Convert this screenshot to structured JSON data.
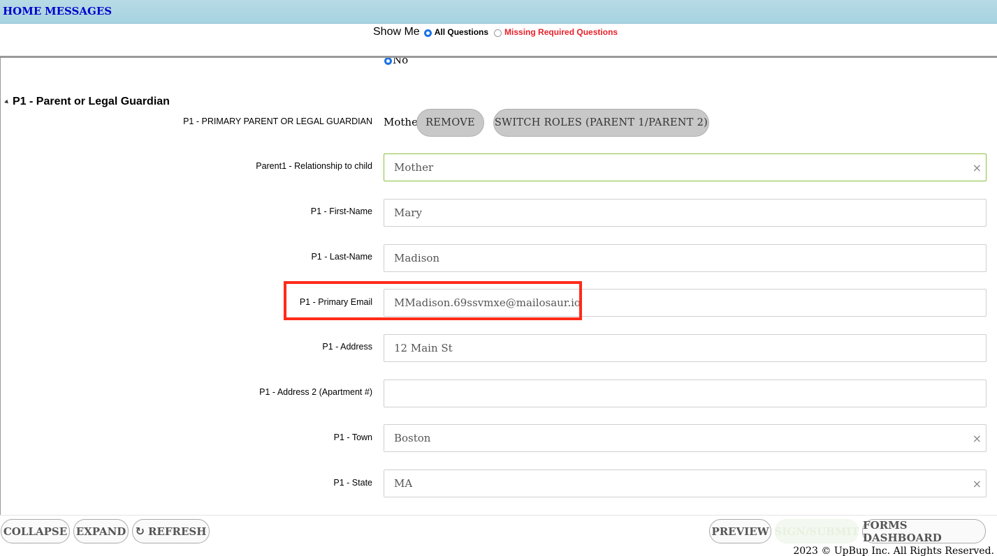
{
  "nav": {
    "home": "HOME",
    "messages": "MESSAGES"
  },
  "show_me": {
    "label": "Show Me",
    "all_questions": "All Questions",
    "missing_required": "Missing Required Questions",
    "selected": "All Questions"
  },
  "prev_answer": {
    "label": "No"
  },
  "section": {
    "title": "P1 - Parent or Legal Guardian"
  },
  "role": {
    "label": "P1 - PRIMARY PARENT OR LEGAL GUARDIAN",
    "value": "Mother",
    "remove_button": "REMOVE",
    "switch_button": "SWITCH ROLES (PARENT 1/PARENT 2)"
  },
  "fields": [
    {
      "label": "Parent1 - Relationship to child",
      "value": "Mother"
    },
    {
      "label": "P1 - First-Name",
      "value": "Mary"
    },
    {
      "label": "P1 - Last-Name",
      "value": "Madison"
    },
    {
      "label": "P1 - Primary Email",
      "value": "MMadison.69ssvmxe@mailosaur.io"
    },
    {
      "label": "P1 - Address",
      "value": "12 Main St"
    },
    {
      "label": "P1 - Address 2 (Apartment #)",
      "value": ""
    },
    {
      "label": "P1 - Town",
      "value": "Boston"
    },
    {
      "label": "P1 - State",
      "value": "MA"
    }
  ],
  "clear_glyph": "×",
  "toolbar": {
    "collapse": "COLLAPSE",
    "expand": "EXPAND",
    "refresh": "REFRESH",
    "refresh_icon": "refresh-icon",
    "preview": "PREVIEW",
    "sign_submit": "SIGN/SUBMIT",
    "forms_dashboard": "FORMS DASHBOARD"
  },
  "footer": {
    "copyright": "2023 © UpBup Inc. All Rights Reserved."
  },
  "colors": {
    "accent_blue": "#1a73e8",
    "warning_red": "#e8202a",
    "highlight_red": "#ff2a1a",
    "valid_green": "#8cbf3f"
  }
}
